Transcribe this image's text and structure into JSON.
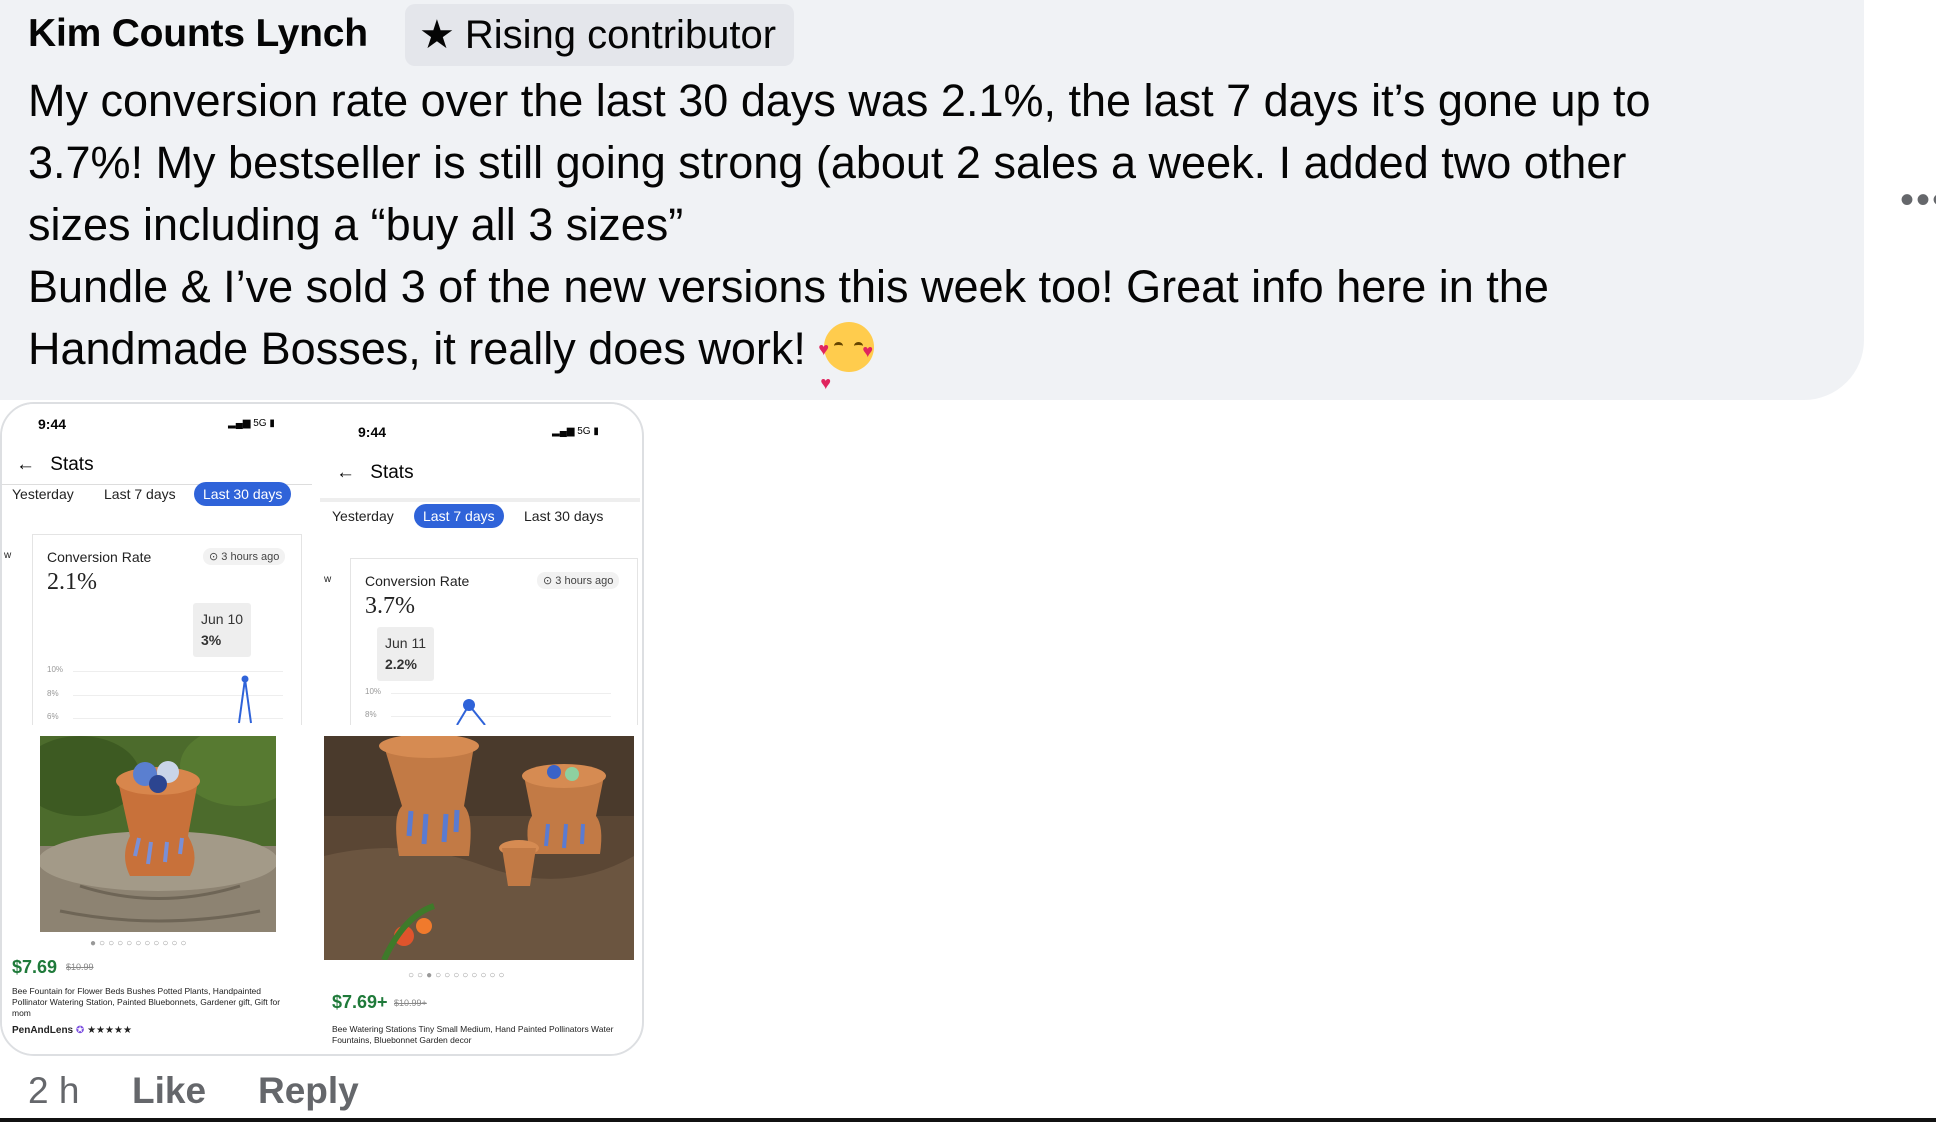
{
  "comment": {
    "author": "Kim Counts Lynch",
    "badge": "Rising contributor",
    "badge_icon": "star-icon",
    "lines": [
      "My conversion rate over the last 30 days was 2.1%, the last 7 days it’s gone up to",
      "3.7%! My bestseller is still going strong (about 2 sales a week. I added two other",
      "sizes including a “buy all 3 sizes”",
      "Bundle & I’ve sold 3 of the new versions this week too! Great info here in the",
      "Handmade Bosses, it really does work!"
    ],
    "more": "•••"
  },
  "screens": [
    {
      "time": "9:44",
      "signal": "5G",
      "title": "Stats",
      "tabs": [
        "Yesterday",
        "Last 7 days",
        "Last 30 days"
      ],
      "active_tab": "Last 30 days",
      "side_label": "w",
      "cr_label": "Conversion Rate",
      "cr_time": "3 hours ago",
      "cr_value": "2.1%",
      "tooltip_date": "Jun 10",
      "tooltip_value": "3%",
      "axis": [
        "10%",
        "8%",
        "6%"
      ],
      "price": "$7.69",
      "orig_price": "$10.99",
      "desc": "Bee Fountain for Flower Beds Bushes Potted Plants, Handpainted Pollinator Watering Station, Painted Bluebonnets, Gardener gift, Gift for mom",
      "shop": "PenAndLens",
      "rating": "★★★★★"
    },
    {
      "time": "9:44",
      "signal": "5G",
      "title": "Stats",
      "tabs": [
        "Yesterday",
        "Last 7 days",
        "Last 30 days"
      ],
      "active_tab": "Last 7 days",
      "side_label": "w",
      "cr_label": "Conversion Rate",
      "cr_time": "3 hours ago",
      "cr_value": "3.7%",
      "tooltip_date": "Jun 11",
      "tooltip_value": "2.2%",
      "axis": [
        "10%",
        "8%"
      ],
      "price": "$7.69+",
      "orig_price": "$10.99+",
      "desc": "Bee Watering Stations Tiny Small Medium, Hand Painted Pollinators Water Fountains, Bluebonnet Garden decor"
    }
  ],
  "footer": {
    "time": "2 h",
    "like": "Like",
    "reply": "Reply"
  },
  "colors": {
    "bubble": "#f0f2f5",
    "badge": "#e4e6eb",
    "etsy_blue": "#2f63d9",
    "price_green": "#1f7a3a",
    "meta_gray": "#65676b"
  }
}
